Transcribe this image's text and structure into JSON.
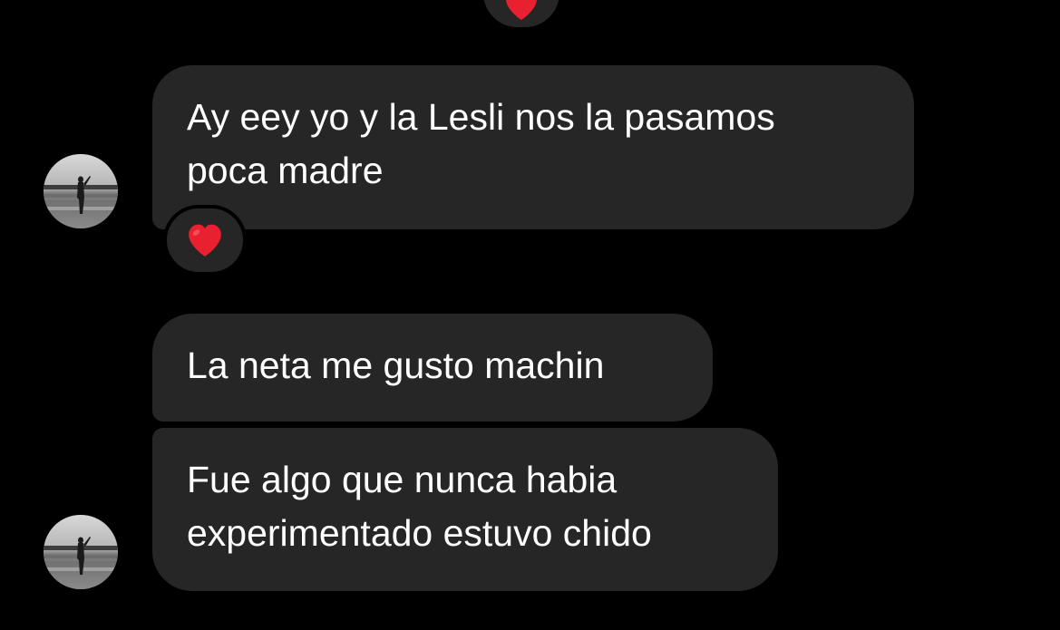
{
  "thread": {
    "colors": {
      "background": "#000000",
      "bubble": "#262626",
      "text": "#ffffff",
      "heart": "#e8202f"
    },
    "messages": [
      {
        "text": "Ay eey yo y la Lesli nos la pasamos\npoca madre",
        "reaction": "heart-icon"
      },
      {
        "text": "La neta me gusto machin"
      },
      {
        "text": "Fue algo que nunca habia\nexperimentado estuvo chido"
      }
    ],
    "top_reaction": "heart-icon",
    "sender_avatar": "avatar-icon"
  }
}
